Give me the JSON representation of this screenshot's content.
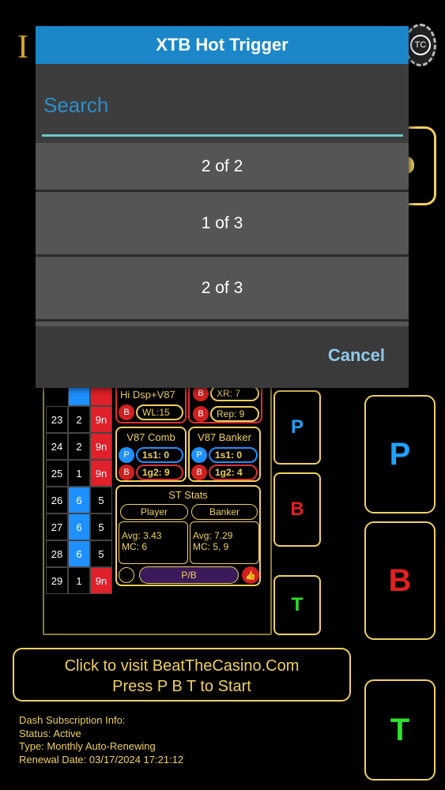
{
  "dialog": {
    "title": "XTB Hot Trigger",
    "search_placeholder": "Search",
    "items": [
      "2 of 2",
      "1 of 3",
      "2 of 3"
    ],
    "cancel_label": "Cancel"
  },
  "header": {
    "chip_label": "TC"
  },
  "roadmap": {
    "rows": [
      {
        "num": "23",
        "val": "2",
        "res": "9n"
      },
      {
        "num": "24",
        "val": "2",
        "res": "9n"
      },
      {
        "num": "25",
        "val": "1",
        "res": "9n"
      },
      {
        "num": "26",
        "val": "6",
        "res": "5"
      },
      {
        "num": "27",
        "val": "6",
        "res": "5"
      },
      {
        "num": "28",
        "val": "6",
        "res": "5"
      },
      {
        "num": "29",
        "val": "1",
        "res": "9n"
      }
    ]
  },
  "panels": {
    "hidsp": {
      "title": "Hi Dsp+V87",
      "b": "B",
      "wl": "WL:15"
    },
    "xr": {
      "b1": "B",
      "xr": "XR: 7",
      "b2": "B",
      "rep": "Rep: 9"
    },
    "v87comb": {
      "title": "V87 Comb",
      "p": "P",
      "p_val": "1s1: 0",
      "b": "B",
      "b_val": "1g2: 9"
    },
    "v87banker": {
      "title": "V87 Banker",
      "p": "P",
      "p_val": "1s1: 0",
      "b": "B",
      "b_val": "1g2: 4"
    },
    "ststats": {
      "title": "ST Stats",
      "player_label": "Player",
      "banker_label": "Banker",
      "player_avg": "Avg: 3.43",
      "player_mc": "MC:  6",
      "banker_avg": "Avg: 7.29",
      "banker_mc": "MC:  5, 9",
      "pb_label": "P/B"
    }
  },
  "buttons": {
    "p": "P",
    "b": "B",
    "t": "T"
  },
  "visit": {
    "line1": "Click to visit BeatTheCasino.Com",
    "line2": "Press P B T to Start"
  },
  "subscription": {
    "title": "Dash Subscription Info:",
    "status": "Status: Active",
    "type": "Type: Monthly Auto-Renewing",
    "renewal": "Renewal Date: 03/17/2024 17:21:12"
  },
  "colors": {
    "gold": "#f0d060",
    "dialog_title_bg": "#1b87c9",
    "blue": "#1ea0ff",
    "red": "#e02020",
    "green": "#2ee02e"
  }
}
